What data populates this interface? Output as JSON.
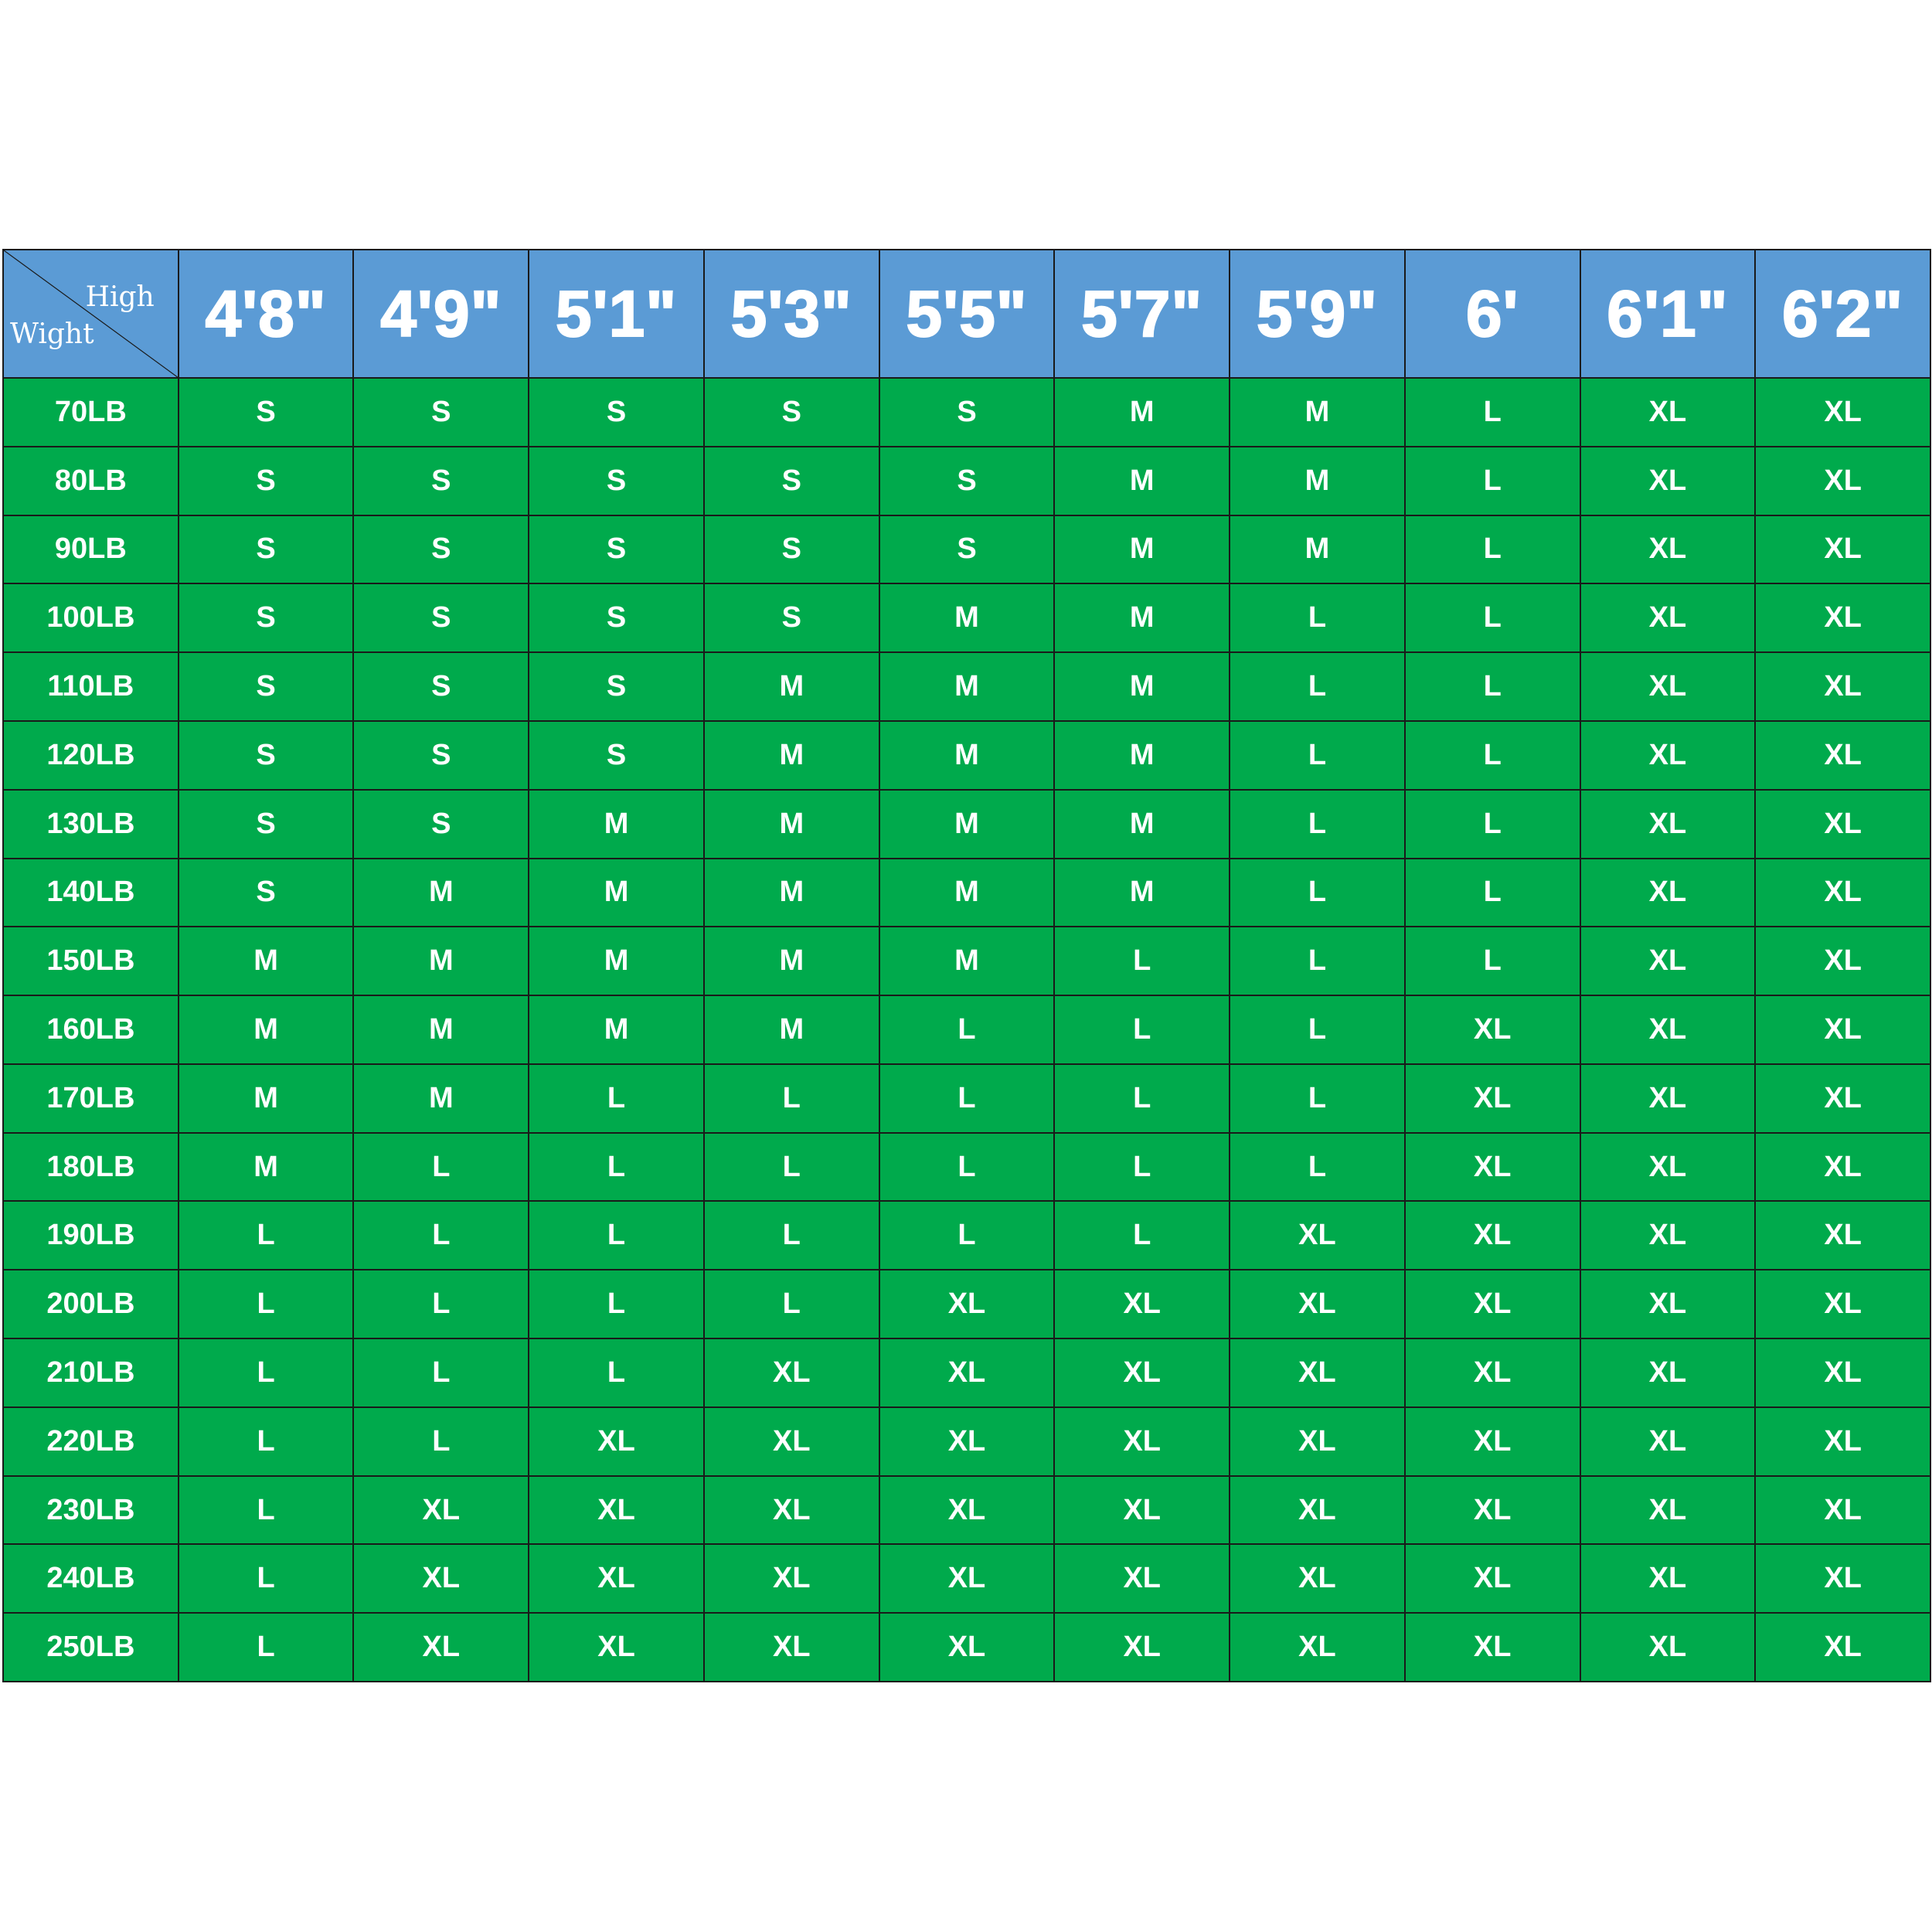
{
  "corner": {
    "col_label": "High",
    "row_label": "Wight"
  },
  "heights": [
    "4'8\"",
    "4'9\"",
    "5'1\"",
    "5'3\"",
    "5'5\"",
    "5'7\"",
    "5'9\"",
    "6'",
    "6'1\"",
    "6'2\""
  ],
  "rows": [
    {
      "weight": "70LB",
      "sizes": [
        "S",
        "S",
        "S",
        "S",
        "S",
        "M",
        "M",
        "L",
        "XL",
        "XL"
      ]
    },
    {
      "weight": "80LB",
      "sizes": [
        "S",
        "S",
        "S",
        "S",
        "S",
        "M",
        "M",
        "L",
        "XL",
        "XL"
      ]
    },
    {
      "weight": "90LB",
      "sizes": [
        "S",
        "S",
        "S",
        "S",
        "S",
        "M",
        "M",
        "L",
        "XL",
        "XL"
      ]
    },
    {
      "weight": "100LB",
      "sizes": [
        "S",
        "S",
        "S",
        "S",
        "M",
        "M",
        "L",
        "L",
        "XL",
        "XL"
      ]
    },
    {
      "weight": "110LB",
      "sizes": [
        "S",
        "S",
        "S",
        "M",
        "M",
        "M",
        "L",
        "L",
        "XL",
        "XL"
      ]
    },
    {
      "weight": "120LB",
      "sizes": [
        "S",
        "S",
        "S",
        "M",
        "M",
        "M",
        "L",
        "L",
        "XL",
        "XL"
      ]
    },
    {
      "weight": "130LB",
      "sizes": [
        "S",
        "S",
        "M",
        "M",
        "M",
        "M",
        "L",
        "L",
        "XL",
        "XL"
      ]
    },
    {
      "weight": "140LB",
      "sizes": [
        "S",
        "M",
        "M",
        "M",
        "M",
        "M",
        "L",
        "L",
        "XL",
        "XL"
      ]
    },
    {
      "weight": "150LB",
      "sizes": [
        "M",
        "M",
        "M",
        "M",
        "M",
        "L",
        "L",
        "L",
        "XL",
        "XL"
      ]
    },
    {
      "weight": "160LB",
      "sizes": [
        "M",
        "M",
        "M",
        "M",
        "L",
        "L",
        "L",
        "XL",
        "XL",
        "XL"
      ]
    },
    {
      "weight": "170LB",
      "sizes": [
        "M",
        "M",
        "L",
        "L",
        "L",
        "L",
        "L",
        "XL",
        "XL",
        "XL"
      ]
    },
    {
      "weight": "180LB",
      "sizes": [
        "M",
        "L",
        "L",
        "L",
        "L",
        "L",
        "L",
        "XL",
        "XL",
        "XL"
      ]
    },
    {
      "weight": "190LB",
      "sizes": [
        "L",
        "L",
        "L",
        "L",
        "L",
        "L",
        "XL",
        "XL",
        "XL",
        "XL"
      ]
    },
    {
      "weight": "200LB",
      "sizes": [
        "L",
        "L",
        "L",
        "L",
        "XL",
        "XL",
        "XL",
        "XL",
        "XL",
        "XL"
      ]
    },
    {
      "weight": "210LB",
      "sizes": [
        "L",
        "L",
        "L",
        "XL",
        "XL",
        "XL",
        "XL",
        "XL",
        "XL",
        "XL"
      ]
    },
    {
      "weight": "220LB",
      "sizes": [
        "L",
        "L",
        "XL",
        "XL",
        "XL",
        "XL",
        "XL",
        "XL",
        "XL",
        "XL"
      ]
    },
    {
      "weight": "230LB",
      "sizes": [
        "L",
        "XL",
        "XL",
        "XL",
        "XL",
        "XL",
        "XL",
        "XL",
        "XL",
        "XL"
      ]
    },
    {
      "weight": "240LB",
      "sizes": [
        "L",
        "XL",
        "XL",
        "XL",
        "XL",
        "XL",
        "XL",
        "XL",
        "XL",
        "XL"
      ]
    },
    {
      "weight": "250LB",
      "sizes": [
        "L",
        "XL",
        "XL",
        "XL",
        "XL",
        "XL",
        "XL",
        "XL",
        "XL",
        "XL"
      ]
    }
  ],
  "colors": {
    "header_bg": "#5b9bd5",
    "body_bg": "#00aa4c",
    "text": "#ffffff",
    "grid": "#1a1a1a"
  }
}
